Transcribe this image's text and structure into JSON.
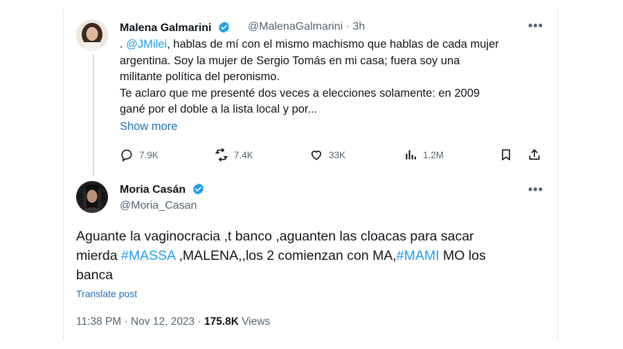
{
  "tweet1": {
    "name": "Malena Galmarini",
    "handle": "@MalenaGalmarini",
    "sep": "·",
    "time": "3h",
    "body_prefix": ". ",
    "mention": "@JMilei",
    "body_line1_rest": ", hablas de mí con el mismo machismo que hablas de cada mujer",
    "body_line2": "argentina. Soy la mujer de Sergio Tomás en mi casa; fuera soy una",
    "body_line3": "militante política del peronismo.",
    "body_line4": "Te aclaro que me presenté dos veces a elecciones solamente: en 2009",
    "body_line5": "gané por el doble a la lista local y por...",
    "show_more": "Show more",
    "stats": {
      "replies": "7.9K",
      "reposts": "7.4K",
      "likes": "33K",
      "views": "1.2M"
    }
  },
  "tweet2": {
    "name": "Moria Casán",
    "handle": "@Moria_Casan",
    "body_part1": "Aguante la vaginocracia ,t banco ,aguanten las cloacas para sacar",
    "body_part2": "mierda ",
    "hashtag1": "#MASSA",
    "body_part3": " ,MALENA,,los 2 comienzan con MA,",
    "hashtag2": "#MAMI",
    "body_part4": " MO los",
    "body_part5": "banca",
    "translate": "Translate post",
    "timestamp": "11:38 PM · Nov 12, 2023 · ",
    "views_count": "175.8K",
    "views_label": " Views"
  },
  "icons": [
    "verified-badge-icon",
    "more-icon",
    "reply-icon",
    "repost-icon",
    "like-icon",
    "views-icon",
    "bookmark-icon",
    "share-icon"
  ],
  "colors": {
    "accent": "#1d9bf0",
    "muted": "#536471",
    "text": "#0f1419"
  }
}
